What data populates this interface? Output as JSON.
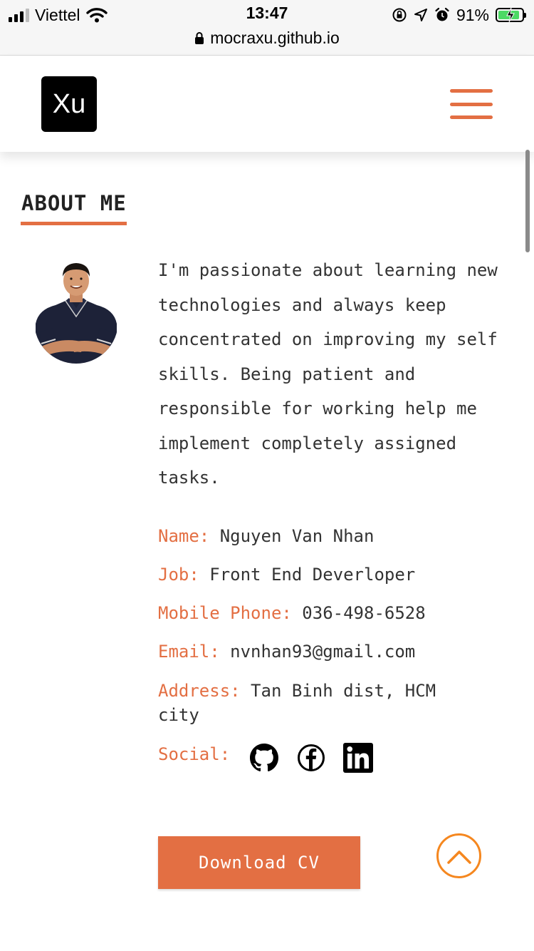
{
  "status_bar": {
    "carrier": "Viettel",
    "time": "13:47",
    "battery_percent": "91%",
    "battery_level": 0.91,
    "url": "mocraxu.github.io",
    "icons": [
      "signal-icon",
      "wifi-icon",
      "orientation-lock-icon",
      "location-icon",
      "alarm-icon",
      "battery-charging-icon",
      "lock-icon"
    ]
  },
  "header": {
    "logo_text": "Xu",
    "menu_icon": "hamburger-menu-icon"
  },
  "about": {
    "title": "ABOUT ME",
    "bio": "I'm passionate about learning new technologies and always keep concentrated on improving my self skills. Being patient and responsible for working help me implement completely assigned tasks.",
    "fields": {
      "name_label": "Name:",
      "name_value": "Nguyen Van Nhan",
      "job_label": "Job:",
      "job_value": "Front End Deverloper",
      "phone_label": "Mobile Phone:",
      "phone_value": "036-498-6528",
      "email_label": "Email:",
      "email_value": "nvnhan93@gmail.com",
      "address_label": "Address:",
      "address_value": "Tan Binh dist, HCM city",
      "social_label": "Social:"
    },
    "socials": [
      "github-icon",
      "facebook-icon",
      "linkedin-icon"
    ],
    "download_label": "Download CV",
    "to_top_icon": "chevron-up-icon"
  },
  "colors": {
    "accent": "#e36f43",
    "to_top": "#f5871f",
    "text": "#333333",
    "logo_bg": "#000000"
  }
}
